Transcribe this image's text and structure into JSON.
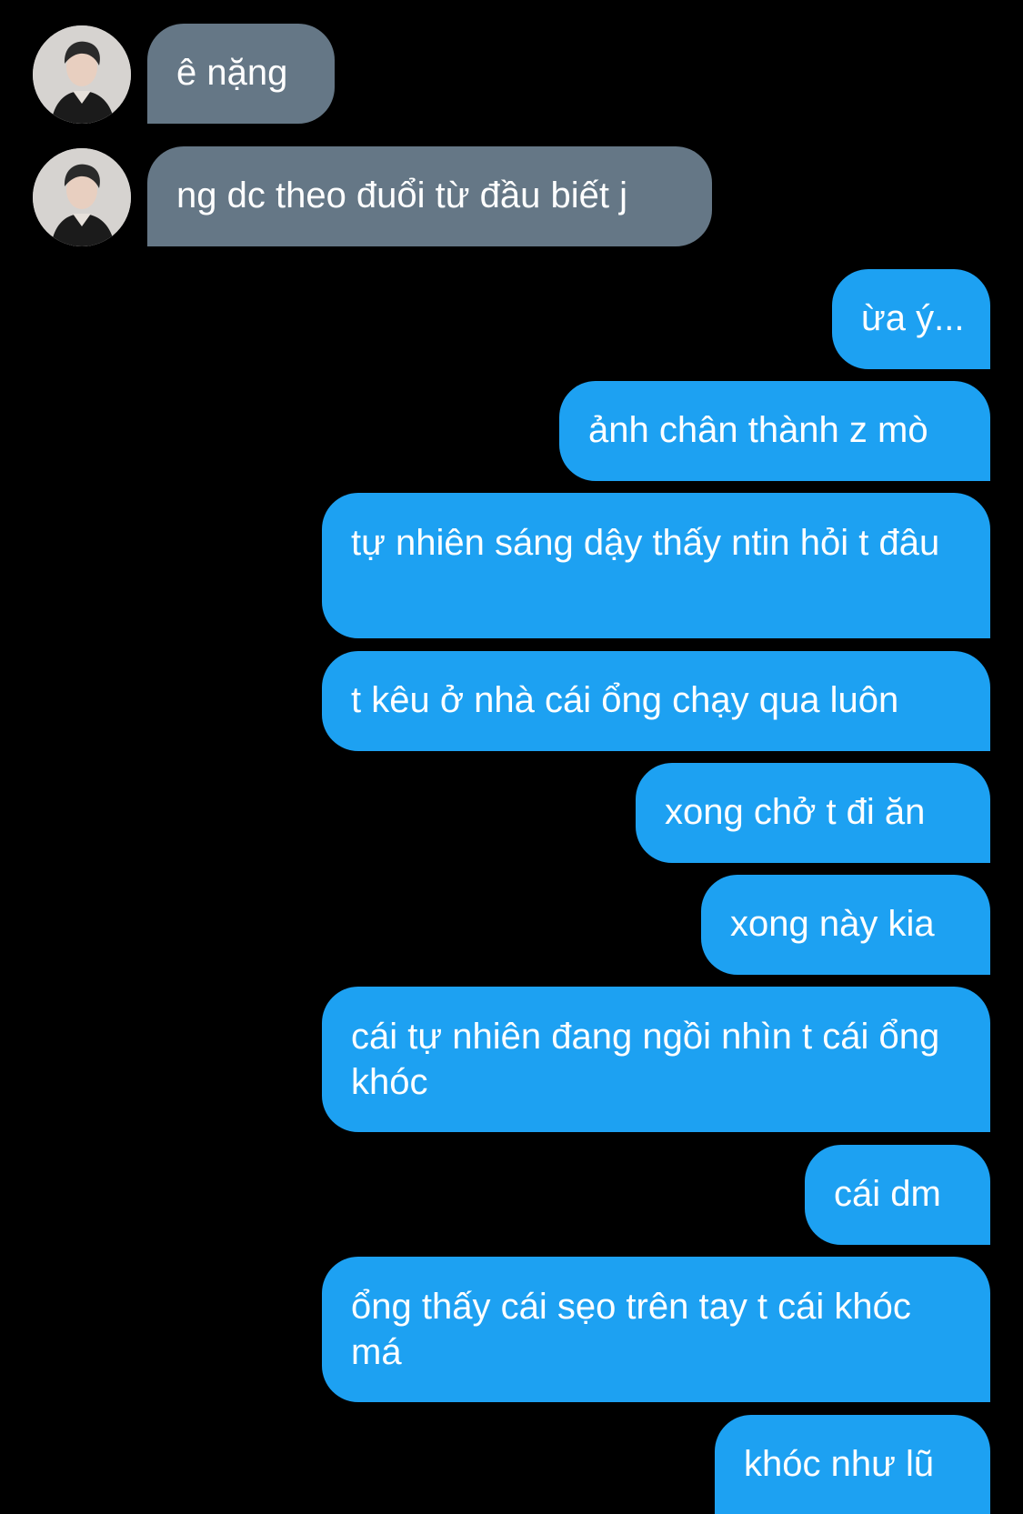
{
  "messages": [
    {
      "direction": "incoming",
      "text": "ê nặng",
      "has_avatar": true
    },
    {
      "direction": "incoming",
      "text": "ng dc theo đuổi từ đầu biết j",
      "has_avatar": true
    },
    {
      "direction": "outgoing",
      "text": "ừa ý..."
    },
    {
      "direction": "outgoing",
      "text": "ảnh chân thành z mò"
    },
    {
      "direction": "outgoing",
      "text": "tự nhiên sáng dậy thấy ntin hỏi t đâu"
    },
    {
      "direction": "outgoing",
      "text": "t kêu ở nhà cái ổng chạy qua luôn"
    },
    {
      "direction": "outgoing",
      "text": "xong chở t đi ăn"
    },
    {
      "direction": "outgoing",
      "text": "xong này kia"
    },
    {
      "direction": "outgoing",
      "text": "cái tự nhiên đang ngồi nhìn t cái ổng khóc"
    },
    {
      "direction": "outgoing",
      "text": "cái dm"
    },
    {
      "direction": "outgoing",
      "text": "ổng thấy cái sẹo trên tay t cái khóc má"
    },
    {
      "direction": "outgoing",
      "text": "khóc như lũ"
    }
  ],
  "colors": {
    "background": "#000000",
    "incoming_bubble": "#657786",
    "outgoing_bubble": "#1da1f2",
    "bubble_text": "#ffffff"
  },
  "icons": {
    "avatar": "contact-avatar-photo"
  }
}
